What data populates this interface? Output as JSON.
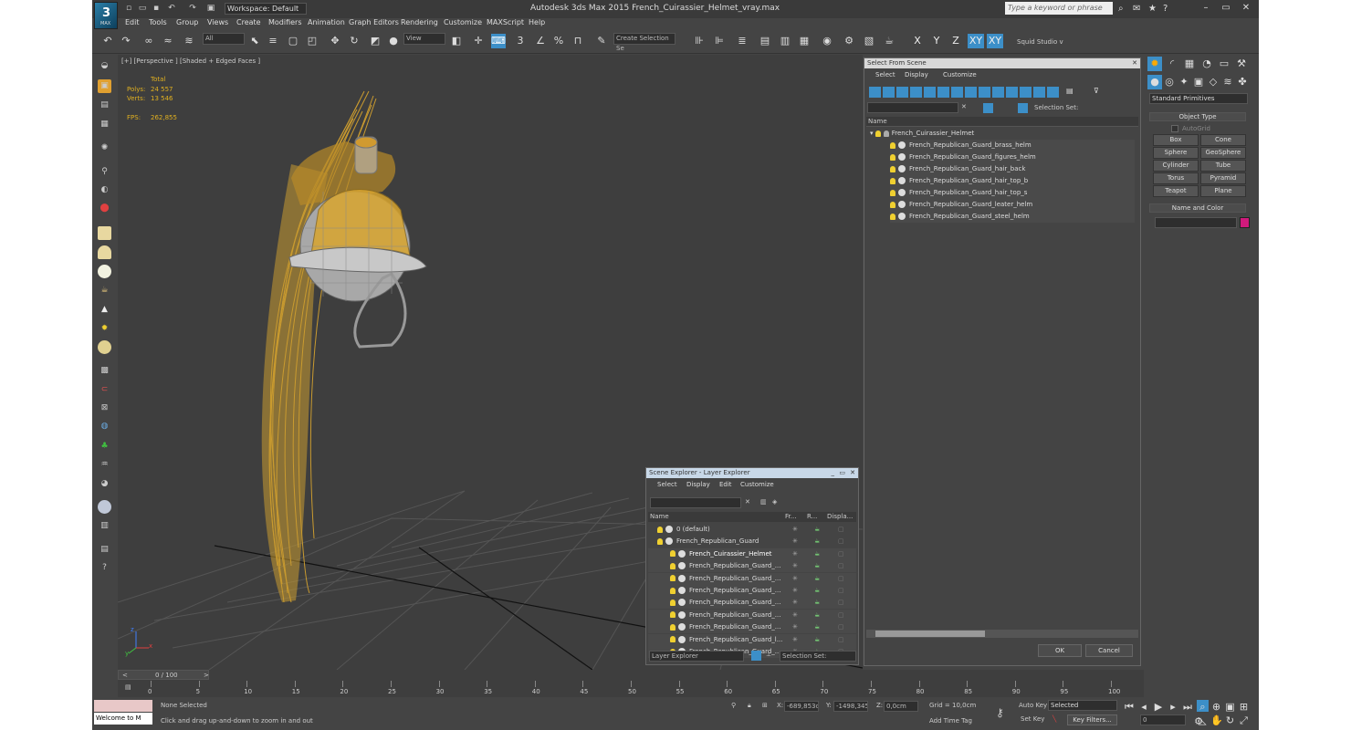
{
  "app": {
    "title": "Autodesk 3ds Max  2015     French_Cuirassier_Helmet_vray.max",
    "logo_text": "MAX",
    "workspace": "Workspace: Default",
    "search_placeholder": "Type a keyword or phrase"
  },
  "menu": [
    "Edit",
    "Tools",
    "Group",
    "Views",
    "Create",
    "Modifiers",
    "Animation",
    "Graph Editors",
    "Rendering",
    "Customize",
    "MAXScript",
    "Help"
  ],
  "toolbar": {
    "filter": "All",
    "ref_coord": "View",
    "selection_set": "Create Selection Se",
    "axis": [
      "X",
      "Y",
      "Z",
      "XY",
      "XY"
    ],
    "studio": "Squid Studio v",
    "snap_3": "3",
    "snap_2_5": "2.5",
    "percent": "%"
  },
  "viewport": {
    "label": "[+] [Perspective ] [Shaded + Edged Faces ]",
    "stats_header": "Total",
    "polys_label": "Polys:",
    "polys": "24 557",
    "verts_label": "Verts:",
    "verts": "13 546",
    "fps_label": "FPS:",
    "fps": "262,855",
    "axis_x": "x",
    "axis_y": "y",
    "axis_z": "z"
  },
  "select_from_scene": {
    "title": "Select From Scene",
    "menu": [
      "Select",
      "Display",
      "Customize"
    ],
    "selection_set_label": "Selection Set:",
    "column_name": "Name",
    "root": "French_Cuirassier_Helmet",
    "items": [
      "French_Republican_Guard_brass_helm",
      "French_Republican_Guard_figures_helm",
      "French_Republican_Guard_hair_back",
      "French_Republican_Guard_hair_top_b",
      "French_Republican_Guard_hair_top_s",
      "French_Republican_Guard_leater_helm",
      "French_Republican_Guard_steel_helm"
    ],
    "ok": "OK",
    "cancel": "Cancel"
  },
  "scene_explorer": {
    "title": "Scene Explorer - Layer Explorer",
    "menu": [
      "Select",
      "Display",
      "Edit",
      "Customize"
    ],
    "columns": [
      "Name",
      "Fr...",
      "R...",
      "Displa..."
    ],
    "rows": [
      {
        "name": "0 (default)",
        "indent": 1
      },
      {
        "name": "French_Republican_Guard",
        "indent": 1
      },
      {
        "name": "French_Cuirassier_Helmet",
        "indent": 2
      },
      {
        "name": "French_Republican_Guard_...",
        "indent": 2
      },
      {
        "name": "French_Republican_Guard_...",
        "indent": 2
      },
      {
        "name": "French_Republican_Guard_...",
        "indent": 2
      },
      {
        "name": "French_Republican_Guard_...",
        "indent": 2
      },
      {
        "name": "French_Republican_Guard_...",
        "indent": 2
      },
      {
        "name": "French_Republican_Guard_...",
        "indent": 2
      },
      {
        "name": "French_Republican_Guard_l...",
        "indent": 2
      },
      {
        "name": "French_Republican_Guard_...",
        "indent": 2
      }
    ],
    "footer_dropdown": "Layer Explorer",
    "footer_selection": "Selection Set:"
  },
  "command_panel": {
    "category": "Standard Primitives",
    "object_type_header": "Object Type",
    "autogrid": "AutoGrid",
    "primitives": [
      "Box",
      "Cone",
      "Sphere",
      "GeoSphere",
      "Cylinder",
      "Tube",
      "Torus",
      "Pyramid",
      "Teapot",
      "Plane"
    ],
    "name_color_header": "Name and Color",
    "swatch_color": "#d01a7c"
  },
  "timeline": {
    "counter": "0 / 100",
    "ticks": [
      "0",
      "5",
      "10",
      "15",
      "20",
      "25",
      "30",
      "35",
      "40",
      "45",
      "50",
      "55",
      "60",
      "65",
      "70",
      "75",
      "80",
      "85",
      "90",
      "95",
      "100"
    ]
  },
  "status": {
    "maxscript": "Welcome to M",
    "none_selected": "None Selected",
    "prompt": "Click and drag up-and-down to zoom in and out",
    "x_label": "X:",
    "x": "-689,853cr",
    "y_label": "Y:",
    "y": "-1498,345c",
    "z_label": "Z:",
    "z": "0,0cm",
    "grid": "Grid = 10,0cm",
    "add_time_tag": "Add Time Tag",
    "auto_key": "Auto Key",
    "set_key": "Set Key",
    "key_mode": "Selected",
    "key_filters": "Key Filters...",
    "frame": "0"
  },
  "colors": {
    "accent": "#3c8fc8",
    "hair": "#d9a52e",
    "background": "#444444"
  }
}
